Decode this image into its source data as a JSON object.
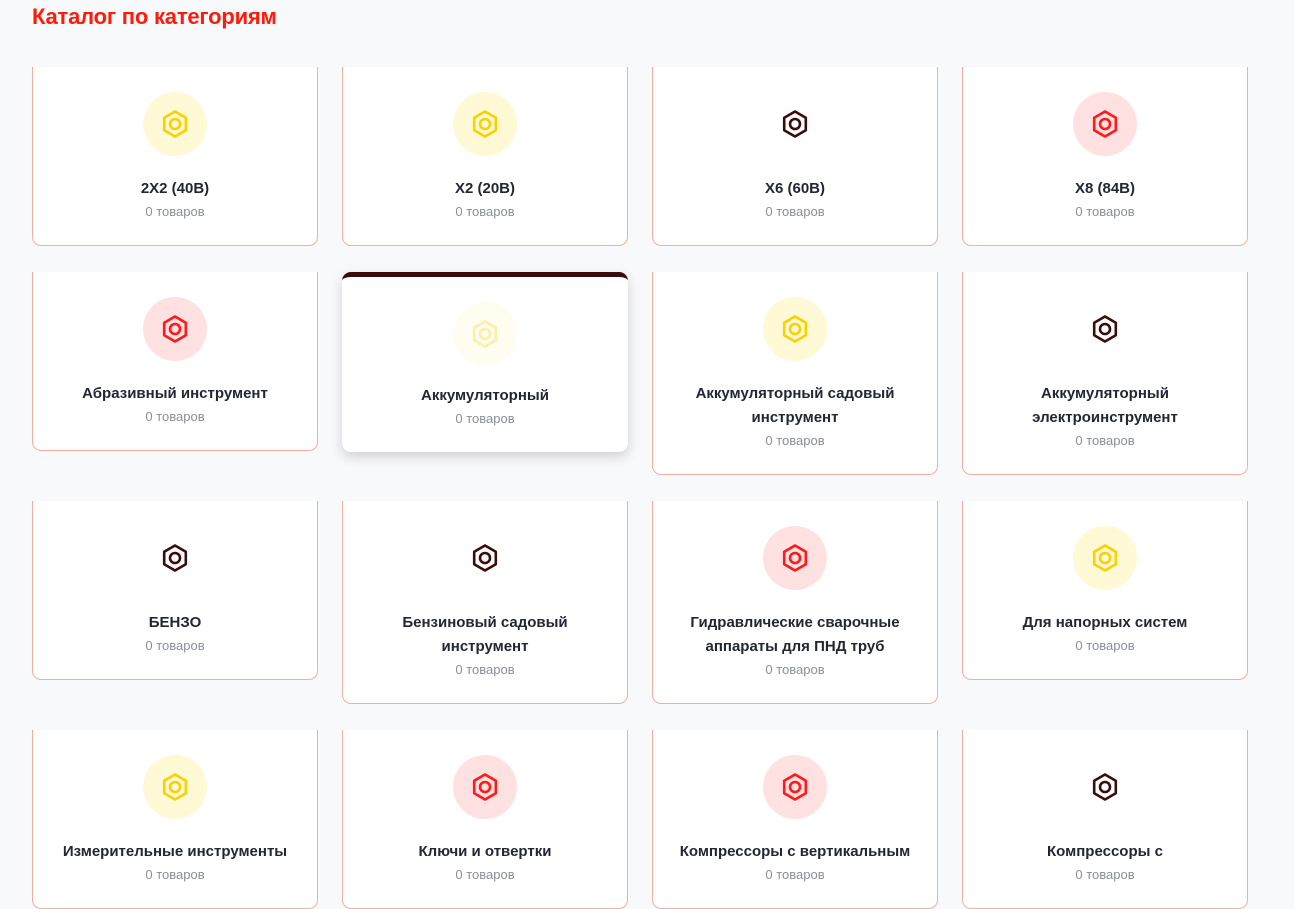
{
  "page": {
    "title": "Каталог по категориям"
  },
  "colors": {
    "yellow": {
      "bg": "#fff9d6",
      "fg": "#ffd000"
    },
    "red": {
      "bg": "#ffe1e1",
      "fg": "#ff1a1a"
    },
    "dark": {
      "bg": "transparent",
      "fg": "#3a0d0d"
    }
  },
  "icon": "hex-nut-icon",
  "rows": [
    [
      {
        "name": "2X2 (40В)",
        "count": "0 товаров",
        "theme": "yellow"
      },
      {
        "name": "X2 (20В)",
        "count": "0 товаров",
        "theme": "yellow"
      },
      {
        "name": "X6 (60В)",
        "count": "0 товаров",
        "theme": "dark"
      },
      {
        "name": "X8 (84В)",
        "count": "0 товаров",
        "theme": "red"
      }
    ],
    [
      {
        "name": "Абразивный инструмент",
        "count": "0 товаров",
        "theme": "red"
      },
      {
        "name": "Аккумуляторный",
        "count": "0 товаров",
        "theme": "yellow",
        "hover": true
      },
      {
        "name": "Аккумуляторный садовый инструмент",
        "count": "0 товаров",
        "theme": "yellow"
      },
      {
        "name": "Аккумуляторный электроинструмент",
        "count": "0 товаров",
        "theme": "dark"
      }
    ],
    [
      {
        "name": "БЕНЗО",
        "count": "0 товаров",
        "theme": "dark"
      },
      {
        "name": "Бензиновый садовый инструмент",
        "count": "0 товаров",
        "theme": "dark"
      },
      {
        "name": "Гидравлические сварочные аппараты для ПНД труб",
        "count": "0 товаров",
        "theme": "red"
      },
      {
        "name": "Для напорных систем",
        "count": "0 товаров",
        "theme": "yellow"
      }
    ],
    [
      {
        "name": "Измерительные инструменты",
        "count": "0 товаров",
        "theme": "yellow"
      },
      {
        "name": "Ключи и отвертки",
        "count": "0 товаров",
        "theme": "red"
      },
      {
        "name": "Компрессоры с вертикальным",
        "count": "0 товаров",
        "theme": "red"
      },
      {
        "name": "Компрессоры с",
        "count": "0 товаров",
        "theme": "dark"
      }
    ]
  ]
}
